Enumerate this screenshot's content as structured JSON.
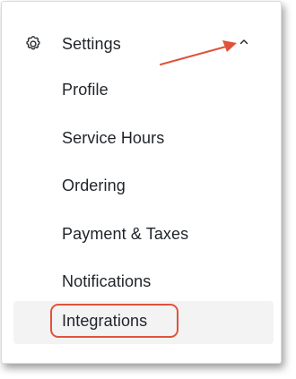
{
  "settings": {
    "label": "Settings",
    "icon": "gear-icon",
    "toggle_icon": "chevron-up-icon",
    "expanded": true
  },
  "menu": {
    "items": [
      {
        "label": "Profile"
      },
      {
        "label": "Service Hours"
      },
      {
        "label": "Ordering"
      },
      {
        "label": "Payment & Taxes"
      },
      {
        "label": "Notifications"
      },
      {
        "label": "Integrations",
        "active": true
      }
    ]
  },
  "annotation": {
    "arrow_color": "#e0533b",
    "highlight_color": "#e0533b"
  }
}
